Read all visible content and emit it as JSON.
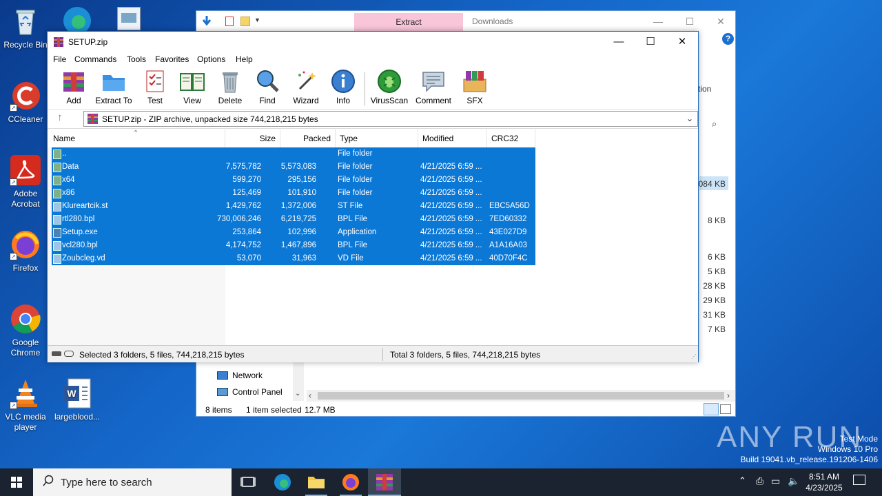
{
  "desktop": {
    "icons": [
      {
        "label": "Recycle Bin"
      },
      {
        "label": "CCleaner"
      },
      {
        "label": "Adobe Acrobat"
      },
      {
        "label": "Firefox"
      },
      {
        "label": "Google Chrome"
      },
      {
        "label": "VLC media player"
      },
      {
        "label": "largeblood..."
      }
    ],
    "watermark": {
      "brand": "ANY RUN",
      "mode": "Test Mode",
      "edition": "Windows 10 Pro",
      "build": "Build 19041.vb_release.191206-1406"
    }
  },
  "explorer": {
    "extract_tab": "Extract",
    "downloads_title": "Downloads",
    "ribbon_partial": "tion",
    "sizes": [
      "084 KB",
      "8 KB",
      "6 KB",
      "5 KB",
      "28 KB",
      "29 KB",
      "31 KB",
      "7 KB"
    ],
    "nav": [
      "Network",
      "Control Panel"
    ],
    "status": {
      "items": "8 items",
      "selected": "1 item selected",
      "size": "12.7 MB"
    }
  },
  "winrar": {
    "title": "SETUP.zip",
    "menu": [
      "File",
      "Commands",
      "Tools",
      "Favorites",
      "Options",
      "Help"
    ],
    "toolbar": [
      "Add",
      "Extract To",
      "Test",
      "View",
      "Delete",
      "Find",
      "Wizard",
      "Info",
      "VirusScan",
      "Comment",
      "SFX"
    ],
    "address": "SETUP.zip - ZIP archive, unpacked size 744,218,215 bytes",
    "columns": [
      "Name",
      "Size",
      "Packed",
      "Type",
      "Modified",
      "CRC32"
    ],
    "rows": [
      {
        "name": "..",
        "size": "",
        "packed": "",
        "type": "File folder",
        "modified": "",
        "crc": "",
        "kind": "folder"
      },
      {
        "name": "Data",
        "size": "7,575,782",
        "packed": "5,573,083",
        "type": "File folder",
        "modified": "4/21/2025 6:59 ...",
        "crc": "",
        "kind": "folder"
      },
      {
        "name": "x64",
        "size": "599,270",
        "packed": "295,156",
        "type": "File folder",
        "modified": "4/21/2025 6:59 ...",
        "crc": "",
        "kind": "folder"
      },
      {
        "name": "x86",
        "size": "125,469",
        "packed": "101,910",
        "type": "File folder",
        "modified": "4/21/2025 6:59 ...",
        "crc": "",
        "kind": "folder"
      },
      {
        "name": "Klureartcik.st",
        "size": "1,429,762",
        "packed": "1,372,006",
        "type": "ST File",
        "modified": "4/21/2025 6:59 ...",
        "crc": "EBC5A56D",
        "kind": "file"
      },
      {
        "name": "rtl280.bpl",
        "size": "730,006,246",
        "packed": "6,219,725",
        "type": "BPL File",
        "modified": "4/21/2025 6:59 ...",
        "crc": "7ED60332",
        "kind": "file"
      },
      {
        "name": "Setup.exe",
        "size": "253,864",
        "packed": "102,996",
        "type": "Application",
        "modified": "4/21/2025 6:59 ...",
        "crc": "43E027D9",
        "kind": "exe"
      },
      {
        "name": "vcl280.bpl",
        "size": "4,174,752",
        "packed": "1,467,896",
        "type": "BPL File",
        "modified": "4/21/2025 6:59 ...",
        "crc": "A1A16A03",
        "kind": "file"
      },
      {
        "name": "Zoubcleg.vd",
        "size": "53,070",
        "packed": "31,963",
        "type": "VD File",
        "modified": "4/21/2025 6:59 ...",
        "crc": "40D70F4C",
        "kind": "file"
      }
    ],
    "status_left": "Selected 3 folders, 5 files, 744,218,215 bytes",
    "status_right": "Total 3 folders, 5 files, 744,218,215 bytes"
  },
  "taskbar": {
    "search_placeholder": "Type here to search",
    "time": "8:51 AM",
    "date": "4/23/2025"
  }
}
